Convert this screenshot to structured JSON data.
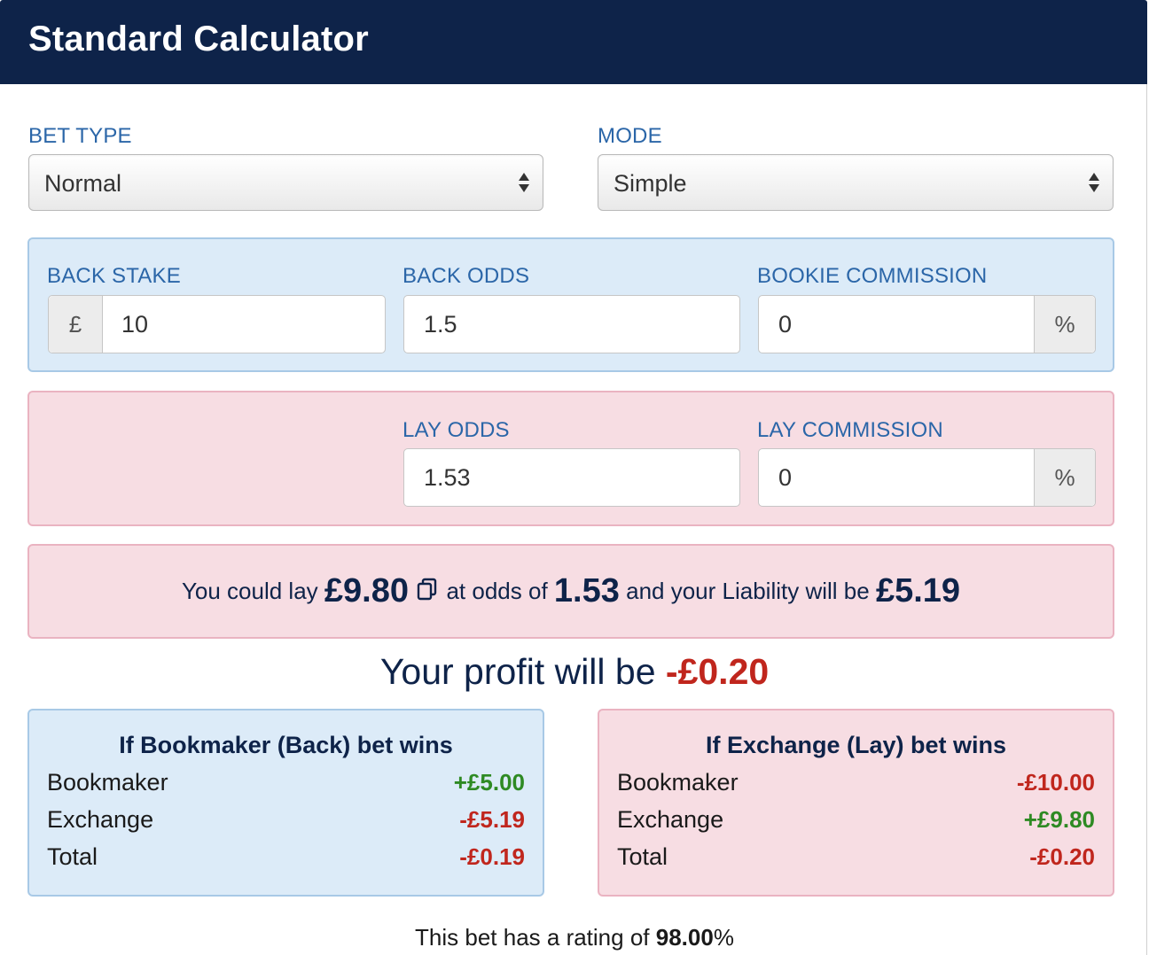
{
  "header": {
    "title": "Standard Calculator"
  },
  "bet_type": {
    "label": "BET TYPE",
    "value": "Normal"
  },
  "mode": {
    "label": "MODE",
    "value": "Simple"
  },
  "back": {
    "stake_label": "BACK STAKE",
    "stake_prefix": "£",
    "stake_value": "10",
    "odds_label": "BACK ODDS",
    "odds_value": "1.5",
    "commission_label": "BOOKIE COMMISSION",
    "commission_value": "0",
    "commission_suffix": "%"
  },
  "lay": {
    "odds_label": "LAY ODDS",
    "odds_value": "1.53",
    "commission_label": "LAY COMMISSION",
    "commission_value": "0",
    "commission_suffix": "%"
  },
  "lay_summary": {
    "text1": "You could lay",
    "stake": "£9.80",
    "text2": "at odds of",
    "odds": "1.53",
    "text3": "and your Liability will be",
    "liability": "£5.19"
  },
  "profit": {
    "text": "Your profit will be",
    "value": "-£0.20"
  },
  "back_wins": {
    "title": "If Bookmaker (Back) bet wins",
    "rows": [
      {
        "label": "Bookmaker",
        "value": "+£5.00"
      },
      {
        "label": "Exchange",
        "value": "-£5.19"
      },
      {
        "label": "Total",
        "value": "-£0.19"
      }
    ]
  },
  "lay_wins": {
    "title": "If Exchange (Lay) bet wins",
    "rows": [
      {
        "label": "Bookmaker",
        "value": "-£10.00"
      },
      {
        "label": "Exchange",
        "value": "+£9.80"
      },
      {
        "label": "Total",
        "value": "-£0.20"
      }
    ]
  },
  "rating": {
    "text": "This bet has a rating of",
    "value": "98.00",
    "suffix": "%"
  },
  "colors": {
    "header_bg": "#0e2349",
    "label_blue": "#2b66a8",
    "negative": "#c0261d",
    "positive": "#2e8a23",
    "back_panel": "#dcebf8",
    "lay_panel": "#f7dde3"
  },
  "icons": {
    "select_arrows": "updown-arrows-icon",
    "copy": "copy-icon"
  }
}
